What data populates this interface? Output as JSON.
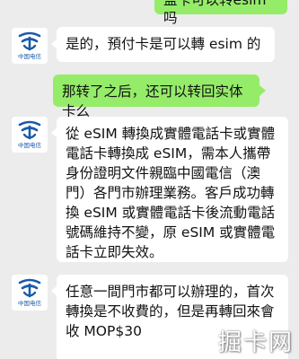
{
  "colors": {
    "background": "#ececec",
    "incoming_bubble": "#ffffff",
    "outgoing_bubble": "#95ec69",
    "brand_blue": "#1a5aa8"
  },
  "contact": {
    "avatar_icon": "china-telecom-logo-icon",
    "avatar_caption": "中国电信"
  },
  "messages": [
    {
      "direction": "out",
      "text": "盖卡可以转esim吗"
    },
    {
      "direction": "in",
      "text": "是的，預付卡是可以轉 esim 的"
    },
    {
      "direction": "out",
      "text": "那转了之后，还可以转回实体卡么"
    },
    {
      "direction": "in",
      "text": "從 eSIM 轉換成實體電話卡或實體電話卡轉換成 eSIM，需本人攜帶身份證明文件親臨中國電信（澳門）各門市辦理業務。客戶成功轉換 eSIM 或實體電話卡後流動電話號碼維持不變，原 eSIM 或實體電話卡立即失效。"
    },
    {
      "direction": "in",
      "text": "任意一間門市都可以辦理的，首次轉換是不收費的，但是再轉回來會收 MOP$30"
    }
  ],
  "watermark": {
    "text": "掘卡网"
  }
}
